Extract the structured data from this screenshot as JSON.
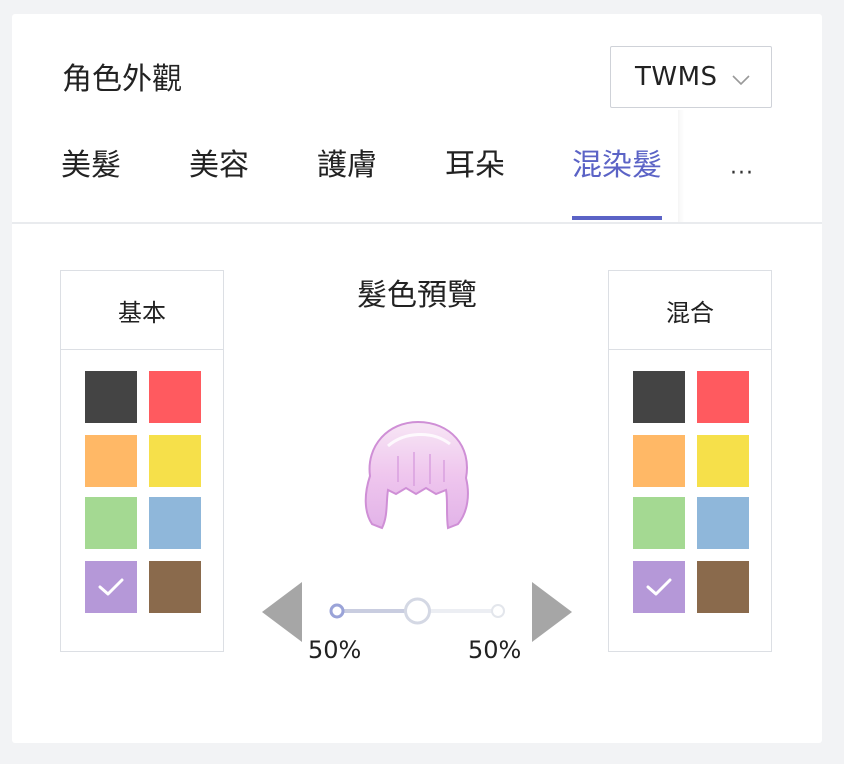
{
  "header": {
    "title": "角色外觀"
  },
  "region_select": {
    "value": "TWMS"
  },
  "tabs": [
    {
      "label": "美髮"
    },
    {
      "label": "美容"
    },
    {
      "label": "護膚"
    },
    {
      "label": "耳朵"
    },
    {
      "label": "混染髮",
      "active": true
    }
  ],
  "tab_more": {
    "label": "···"
  },
  "base_panel": {
    "title": "基本",
    "selected": "purple"
  },
  "mix_panel": {
    "title": "混合",
    "selected": "purple"
  },
  "preview": {
    "title": "髮色預覽",
    "left_percent": "50%",
    "right_percent": "50%",
    "mix_ratio": 0.5
  },
  "palette": [
    {
      "name": "black",
      "hex": "#444444"
    },
    {
      "name": "red",
      "hex": "#ff5a5f"
    },
    {
      "name": "orange",
      "hex": "#ffb866"
    },
    {
      "name": "yellow",
      "hex": "#f6e04a"
    },
    {
      "name": "green",
      "hex": "#a4d992"
    },
    {
      "name": "blue",
      "hex": "#8fb7da"
    },
    {
      "name": "purple",
      "hex": "#b598d8"
    },
    {
      "name": "brown",
      "hex": "#8a6a4c"
    }
  ],
  "colors": {
    "accent": "#5b63c6",
    "arrow": "#a6a6a6",
    "slider_track": "#d8dbe6"
  },
  "icons": [
    "chevron-down-icon",
    "check-icon",
    "arrow-left-icon",
    "arrow-right-icon"
  ]
}
